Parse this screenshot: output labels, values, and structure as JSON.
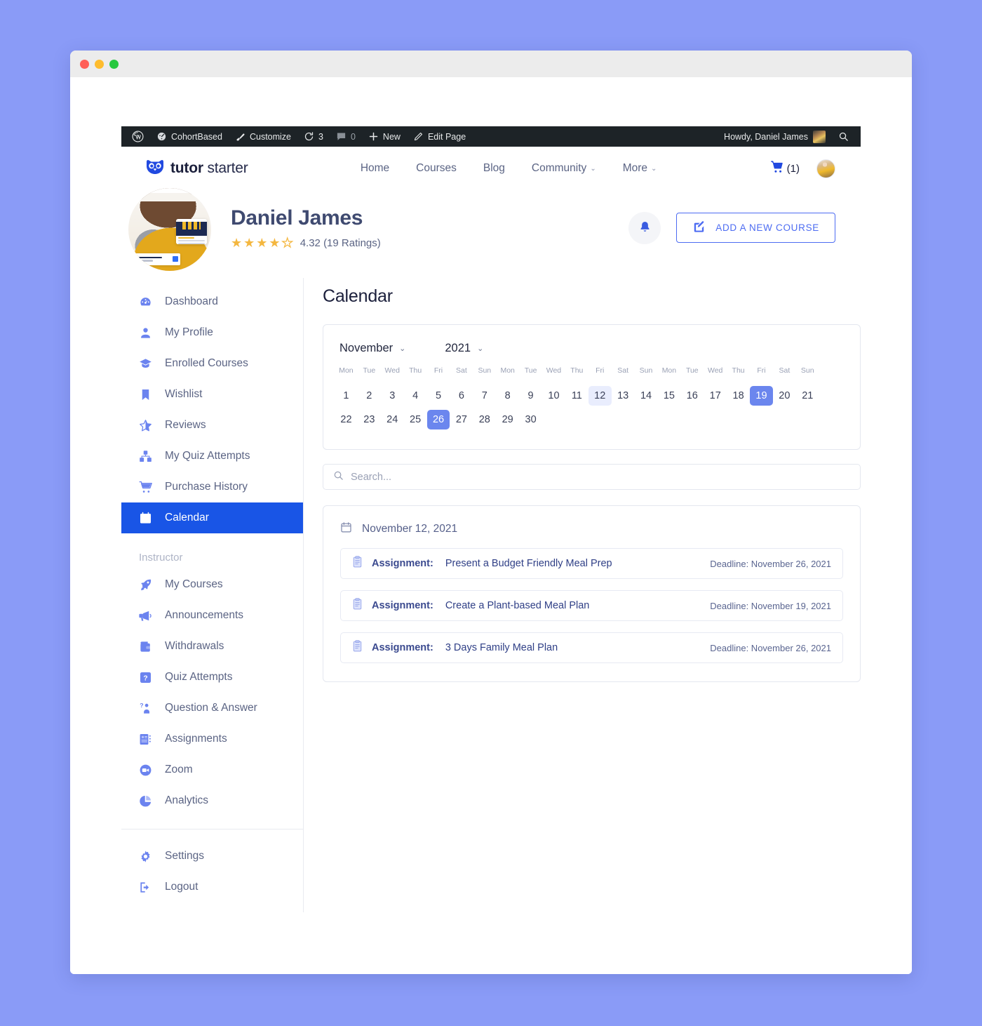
{
  "window": {
    "dots": [
      "close",
      "minimize",
      "maximize"
    ]
  },
  "adminbar": {
    "items": [
      {
        "icon": "wordpress-icon",
        "label": ""
      },
      {
        "icon": "dashboard-icon",
        "label": "CohortBased"
      },
      {
        "icon": "brush-icon",
        "label": "Customize"
      },
      {
        "icon": "updates-icon",
        "label": "3"
      },
      {
        "icon": "comment-icon",
        "label": "0"
      },
      {
        "icon": "plus-icon",
        "label": "New"
      },
      {
        "icon": "pencil-icon",
        "label": "Edit Page"
      }
    ],
    "howdy": "Howdy, Daniel James",
    "search_icon": "search-icon"
  },
  "header": {
    "logo_bold": "tutor",
    "logo_light": "starter",
    "logo_icon": "owl-icon",
    "nav": [
      {
        "label": "Home",
        "caret": false
      },
      {
        "label": "Courses",
        "caret": false
      },
      {
        "label": "Blog",
        "caret": false
      },
      {
        "label": "Community",
        "caret": true
      },
      {
        "label": "More",
        "caret": true
      }
    ],
    "cart_count": "(1)",
    "cart_icon": "cart-icon",
    "avatar": "user-avatar"
  },
  "profile": {
    "name": "Daniel James",
    "stars_filled": 4,
    "stars_total": 5,
    "rating_text": "4.32 (19 Ratings)",
    "bell_icon": "bell-icon",
    "add_course_label": "ADD A NEW COURSE",
    "add_course_icon": "edit-square-icon"
  },
  "sidebar": {
    "items": [
      {
        "label": "Dashboard",
        "icon": "speedometer-icon",
        "active": false
      },
      {
        "label": "My Profile",
        "icon": "person-icon",
        "active": false
      },
      {
        "label": "Enrolled Courses",
        "icon": "graduation-cap-icon",
        "active": false
      },
      {
        "label": "Wishlist",
        "icon": "bookmark-icon",
        "active": false
      },
      {
        "label": "Reviews",
        "icon": "half-star-icon",
        "active": false
      },
      {
        "label": "My Quiz Attempts",
        "icon": "quiz-blocks-icon",
        "active": false
      },
      {
        "label": "Purchase History",
        "icon": "cart-icon",
        "active": false
      },
      {
        "label": "Calendar",
        "icon": "calendar-icon",
        "active": true
      }
    ],
    "group_label": "Instructor",
    "instructor_items": [
      {
        "label": "My Courses",
        "icon": "rocket-icon"
      },
      {
        "label": "Announcements",
        "icon": "megaphone-icon"
      },
      {
        "label": "Withdrawals",
        "icon": "wallet-icon"
      },
      {
        "label": "Quiz Attempts",
        "icon": "question-box-icon"
      },
      {
        "label": "Question & Answer",
        "icon": "question-person-icon"
      },
      {
        "label": "Assignments",
        "icon": "assignment-list-icon"
      },
      {
        "label": "Zoom",
        "icon": "zoom-camera-icon"
      },
      {
        "label": "Analytics",
        "icon": "pie-chart-icon"
      }
    ],
    "footer_items": [
      {
        "label": "Settings",
        "icon": "gear-icon"
      },
      {
        "label": "Logout",
        "icon": "logout-icon"
      }
    ]
  },
  "main": {
    "title": "Calendar",
    "month": "November",
    "year": "2021",
    "weekday_labels": [
      "Mon",
      "Tue",
      "Wed",
      "Thu",
      "Fri",
      "Sat",
      "Sun",
      "Mon",
      "Tue",
      "Wed",
      "Thu",
      "Fri",
      "Sat",
      "Sun",
      "Mon",
      "Tue",
      "Wed",
      "Thu",
      "Fri",
      "Sat",
      "Sun"
    ],
    "days_row1": [
      1,
      2,
      3,
      4,
      5,
      6,
      7,
      8,
      9,
      10,
      11,
      12,
      13,
      14,
      15,
      16,
      17,
      18,
      19,
      20,
      21
    ],
    "days_row2": [
      22,
      23,
      24,
      25,
      26,
      27,
      28,
      29,
      30
    ],
    "day_soft": 12,
    "day_selected_row1": 19,
    "day_selected_row2": 26,
    "search_placeholder": "Search...",
    "search_value": "",
    "search_icon": "search-icon",
    "events_date": "November 12, 2021",
    "events_date_icon": "calendar-icon",
    "events": [
      {
        "icon": "clipboard-icon",
        "type": "Assignment:",
        "title": "Present a Budget Friendly Meal Prep",
        "deadline": "Deadline: November 26, 2021"
      },
      {
        "icon": "clipboard-icon",
        "type": "Assignment:",
        "title": "Create a Plant-based Meal Plan",
        "deadline": "Deadline: November 19, 2021"
      },
      {
        "icon": "clipboard-icon",
        "type": "Assignment:",
        "title": "3 Days Family Meal Plan",
        "deadline": "Deadline: November 26, 2021"
      }
    ]
  },
  "colors": {
    "accent": "#1955e6",
    "accent_soft": "#6b86ee",
    "accent_pale": "#e9edfd",
    "star": "#f4b740",
    "text_dark": "#1b1f3b",
    "text_muted": "#5b6484",
    "adminbar_bg": "#1d2327",
    "page_bg": "#8a9bf7"
  }
}
